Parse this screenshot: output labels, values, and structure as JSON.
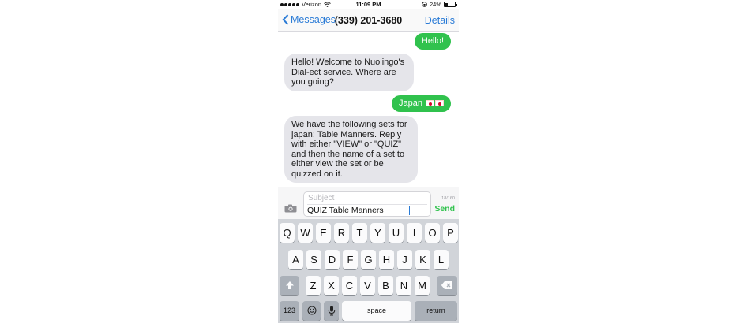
{
  "status_bar": {
    "carrier": "Verizon",
    "time": "11:09 PM",
    "battery": "24%",
    "battery_level": 0.24,
    "icons": [
      "signal-dots-icon",
      "wifi-icon",
      "rotation-lock-icon",
      "battery-icon"
    ]
  },
  "nav": {
    "back_label": "Messages",
    "title": "(339) 201-3680",
    "details_label": "Details"
  },
  "messages": [
    {
      "direction": "outgoing",
      "text": "Hello!"
    },
    {
      "direction": "incoming",
      "text": "Hello! Welcome to Nuolingo's Dial-ect service. Where are you going?"
    },
    {
      "direction": "outgoing",
      "text": "Japan",
      "emoji": [
        "japan-flag-icon",
        "japan-flag-icon"
      ]
    },
    {
      "direction": "incoming",
      "text": "We have the following sets for japan: Table Manners. Reply with either \"VIEW\" or \"QUIZ\" and then the name of a set to either view the set or be quizzed on it."
    }
  ],
  "compose": {
    "subject_placeholder": "Subject",
    "body_value": "QUIZ Table Manners",
    "counter": "18/160",
    "send_label": "Send",
    "camera_icon": "camera-icon"
  },
  "keyboard": {
    "row1": [
      "Q",
      "W",
      "E",
      "R",
      "T",
      "Y",
      "U",
      "I",
      "O",
      "P"
    ],
    "row2": [
      "A",
      "S",
      "D",
      "F",
      "G",
      "H",
      "J",
      "K",
      "L"
    ],
    "row3": [
      "Z",
      "X",
      "C",
      "V",
      "B",
      "N",
      "M"
    ],
    "numbers_label": "123",
    "space_label": "space",
    "return_label": "return",
    "icons": [
      "shift-icon",
      "delete-icon",
      "emoji-icon",
      "microphone-icon"
    ]
  },
  "colors": {
    "accent_blue": "#2a7bd6",
    "outgoing_bubble": "#30c24d",
    "incoming_bubble": "#e5e5ea",
    "keyboard_bg": "#d1d4d9"
  }
}
